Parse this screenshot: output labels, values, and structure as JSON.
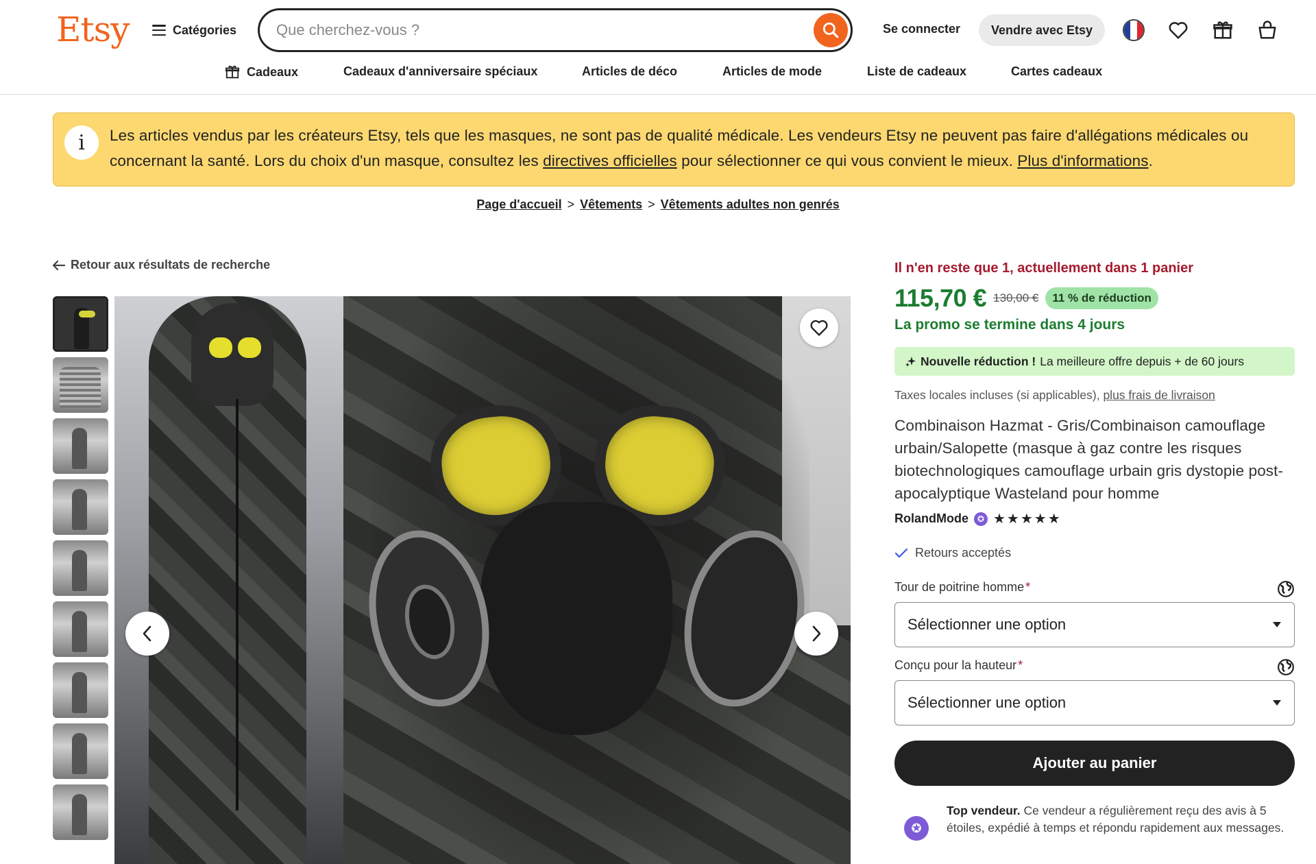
{
  "header": {
    "logo": "Etsy",
    "categories_label": "Catégories",
    "search_placeholder": "Que cherchez-vous ?",
    "signin_label": "Se connecter",
    "sell_label": "Vendre avec Etsy",
    "colors": {
      "brand": "#F1641E"
    }
  },
  "subnav": {
    "items": [
      "Cadeaux",
      "Cadeaux d'anniversaire spéciaux",
      "Articles de déco",
      "Articles de mode",
      "Liste de cadeaux",
      "Cartes cadeaux"
    ]
  },
  "banner": {
    "text_1": "Les articles vendus par les créateurs Etsy, tels que les masques, ne sont pas de qualité médicale. Les vendeurs Etsy ne peuvent pas faire d'allégations médicales ou concernant la santé. Lors du choix d'un masque, consultez les ",
    "link_1": "directives officielles",
    "text_2": " pour sélectionner ce qui vous convient le mieux. ",
    "link_2": "Plus d'informations",
    "text_3": "."
  },
  "breadcrumb": {
    "items": [
      "Page d'accueil",
      "Vêtements",
      "Vêtements adultes non genrés"
    ],
    "separator": ">"
  },
  "back_label": "Retour aux résultats de recherche",
  "product": {
    "stock_message": "Il n'en reste que 1, actuellement dans 1 panier",
    "price": "115,70 €",
    "old_price": "130,00 €",
    "discount": "11 % de réduction",
    "promo_end": "La promo se termine dans 4 jours",
    "new_deal_bold": "Nouvelle réduction !",
    "new_deal_text": "La meilleure offre depuis + de 60 jours",
    "tax_text": "Taxes locales incluses (si applicables), ",
    "tax_link": "plus frais de livraison",
    "title": "Combinaison Hazmat - Gris/Combinaison camouflage urbain/Salopette (masque à gaz contre les risques biotechnologiques camouflage urbain gris dystopie post-apocalyptique Wasteland pour homme",
    "seller": "RolandMode",
    "rating_stars": "★★★★★",
    "rating_value": 5,
    "returns": "Retours acceptés",
    "option_1_label": "Tour de poitrine homme",
    "option_1_value": "Sélectionner une option",
    "option_2_label": "Conçu pour la hauteur",
    "option_2_value": "Sélectionner une option",
    "required_mark": "*",
    "add_to_cart": "Ajouter au panier",
    "top_seller_bold": "Top vendeur.",
    "top_seller_text": " Ce vendeur a régulièrement reçu des avis à 5 étoiles, expédié à temps et répondu rapidement aux messages.",
    "colors": {
      "price": "#1b7d2f",
      "stock": "#A61A2E",
      "discount_bg": "#9fe3a6",
      "deal_bg": "#d3f6c9",
      "badge": "#7e5bd6"
    }
  },
  "gallery": {
    "thumbnail_count": 9,
    "selected_index": 0
  },
  "icons": [
    "hamburger-icon",
    "search-icon",
    "flag-fr-icon",
    "heart-icon",
    "gift-icon",
    "basket-icon",
    "info-icon",
    "arrow-left-icon",
    "chevron-left-icon",
    "chevron-right-icon",
    "globe-icon",
    "check-icon",
    "sparkle-icon",
    "star-badge-icon",
    "caret-down-icon"
  ]
}
